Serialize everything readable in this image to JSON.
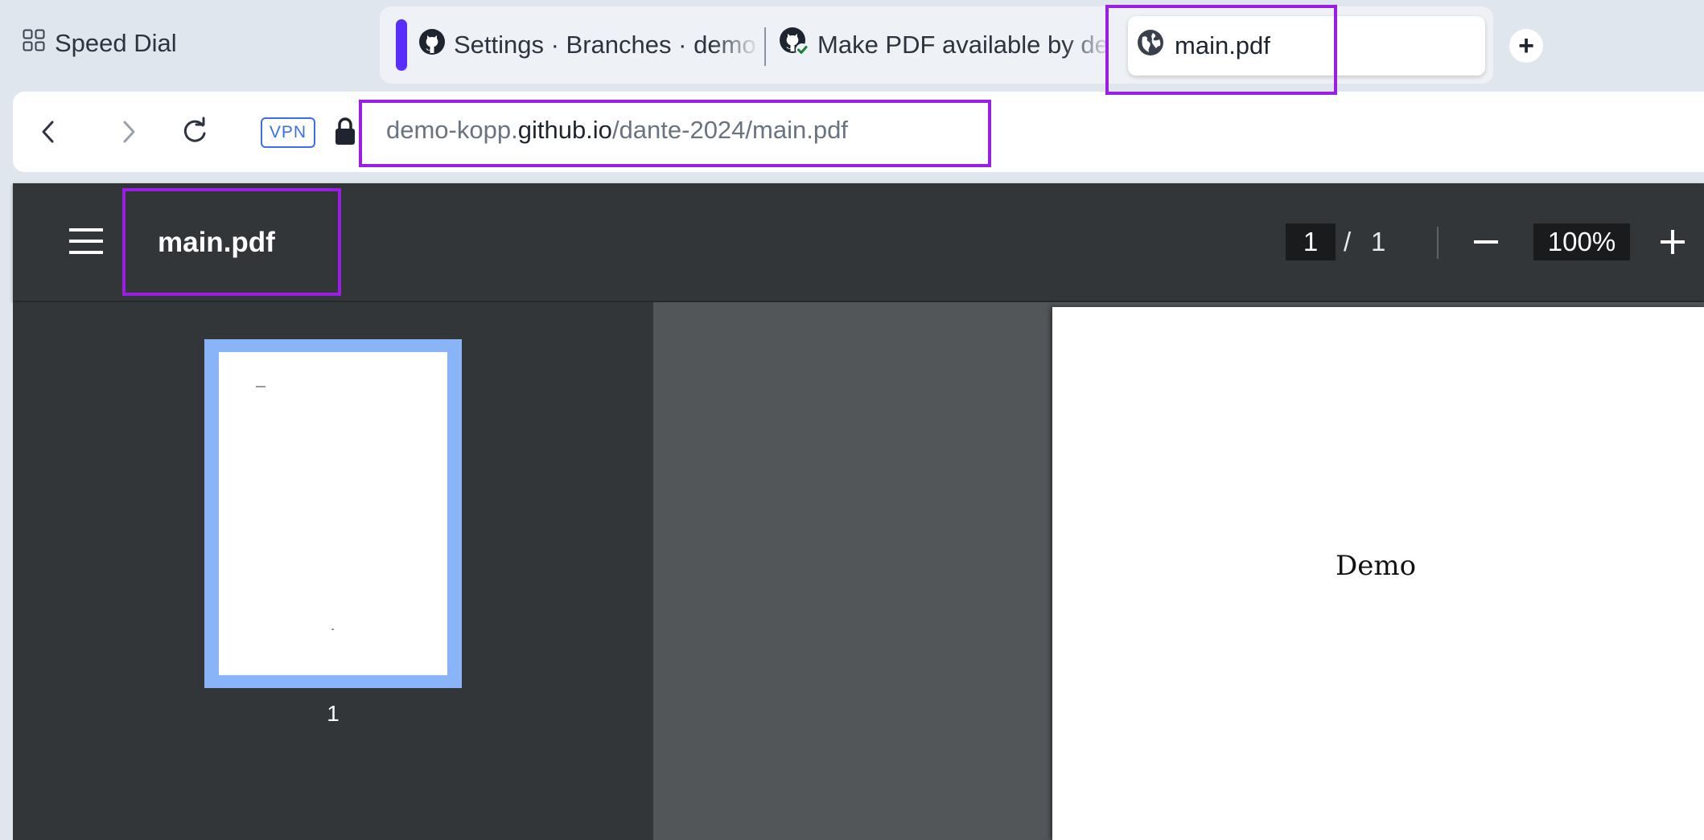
{
  "browser": {
    "speed_dial": {
      "label": "Speed Dial",
      "icon": "speed-dial-grid-icon"
    },
    "tabs": [
      {
        "title": "Settings · Branches · demo",
        "icon": "github-icon"
      },
      {
        "title": "Make PDF available by de",
        "icon": "github-check-icon"
      },
      {
        "title": "main.pdf",
        "icon": "globe-icon",
        "active": true
      }
    ],
    "new_tab_label": "+",
    "address": {
      "url_prefix": "demo-kopp.",
      "url_host": "github.io",
      "url_path": "/dante-2024/main.pdf",
      "vpn_label": "VPN"
    }
  },
  "viewer": {
    "title": "main.pdf",
    "current_page": "1",
    "page_separator": "/",
    "total_pages": "1",
    "zoom": "100%",
    "thumbnails": [
      {
        "label": "1"
      }
    ],
    "page_text": "Demo"
  },
  "colors": {
    "highlight": "#9b1ee6",
    "tab_group": "#5a2dff",
    "thumbnail_selected": "#8ab4f8",
    "viewer_toolbar": "#323639"
  }
}
